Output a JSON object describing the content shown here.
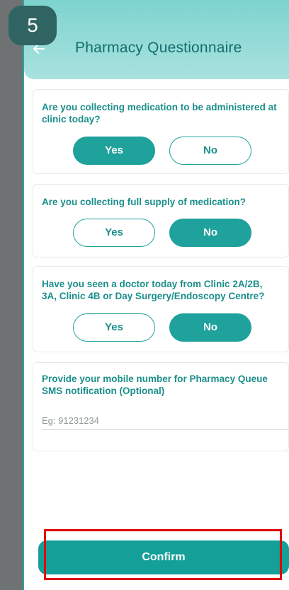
{
  "step_badge": "5",
  "header": {
    "title": "Pharmacy Questionnaire"
  },
  "questions": [
    {
      "text": "Are you collecting medication to be administered at clinic today?",
      "yes": "Yes",
      "no": "No",
      "selected": "Yes"
    },
    {
      "text": "Are you collecting full supply of medication?",
      "yes": "Yes",
      "no": "No",
      "selected": "No"
    },
    {
      "text": "Have you seen a doctor today from Clinic 2A/2B, 3A, Clinic 4B or Day Surgery/Endoscopy Centre?",
      "yes": "Yes",
      "no": "No",
      "selected": "No"
    }
  ],
  "mobile": {
    "label": "Provide your mobile number for Pharmacy Queue SMS notification (Optional)",
    "placeholder": "Eg: 91231234"
  },
  "confirm_label": "Confirm",
  "colors": {
    "accent": "#1fa19c",
    "header": "#a8e2df",
    "highlight": "#e00000"
  }
}
